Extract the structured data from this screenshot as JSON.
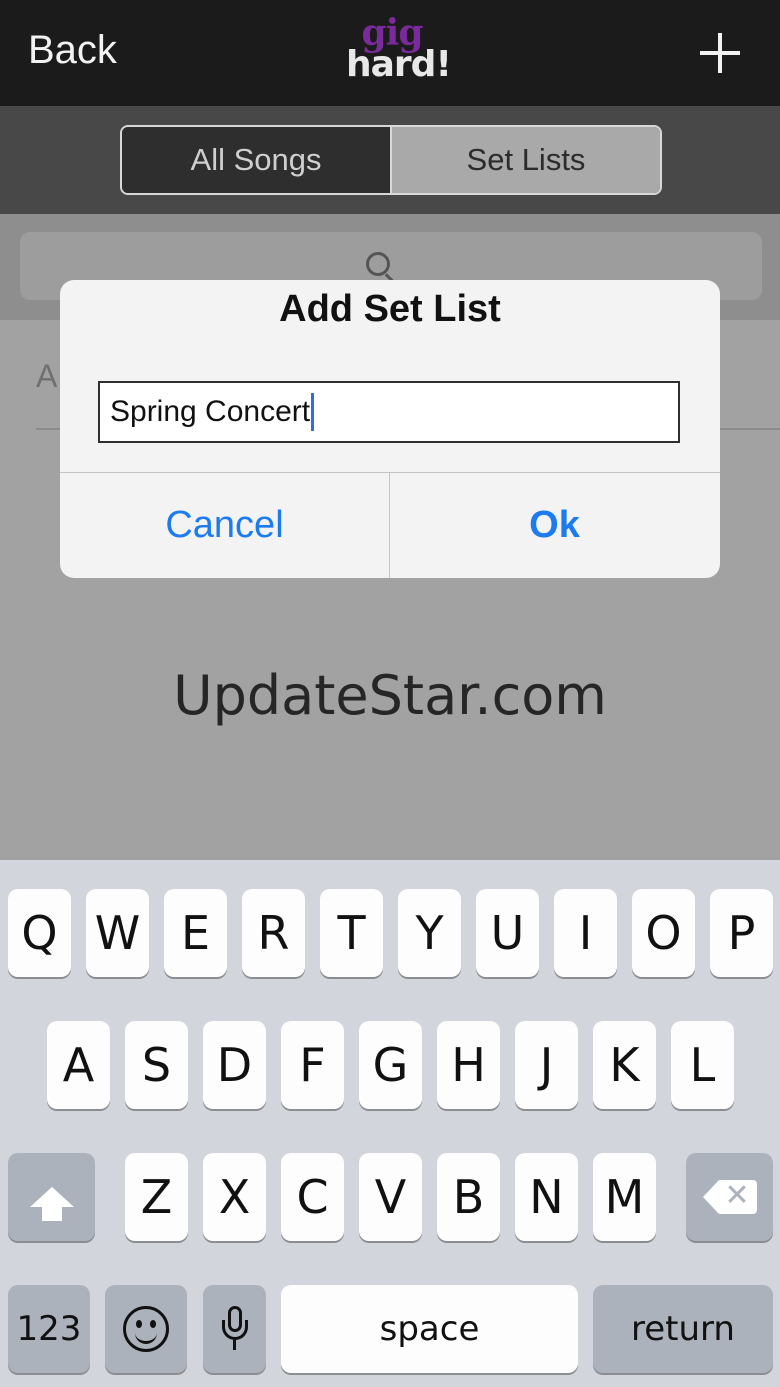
{
  "navbar": {
    "back_label": "Back",
    "logo_top": "gig",
    "logo_bottom": "hard!",
    "add_icon": "plus-icon"
  },
  "segments": {
    "all_songs": "All Songs",
    "set_lists": "Set Lists",
    "selected": "All Songs"
  },
  "background_list": {
    "first_letter": "A"
  },
  "watermark": "UpdateStar.com",
  "alert": {
    "title": "Add Set List",
    "input_value": "Spring Concert",
    "cancel_label": "Cancel",
    "ok_label": "Ok"
  },
  "keyboard": {
    "row1": [
      "Q",
      "W",
      "E",
      "R",
      "T",
      "Y",
      "U",
      "I",
      "O",
      "P"
    ],
    "row2": [
      "A",
      "S",
      "D",
      "F",
      "G",
      "H",
      "J",
      "K",
      "L"
    ],
    "row3": [
      "Z",
      "X",
      "C",
      "V",
      "B",
      "N",
      "M"
    ],
    "numbers_label": "123",
    "space_label": "space",
    "return_label": "return",
    "shift_icon": "shift-icon",
    "delete_icon": "delete-icon",
    "emoji_icon": "emoji-icon",
    "mic_icon": "microphone-icon"
  },
  "colors": {
    "accent": "#1d7bf0",
    "logo_purple": "#7a2a9a"
  }
}
